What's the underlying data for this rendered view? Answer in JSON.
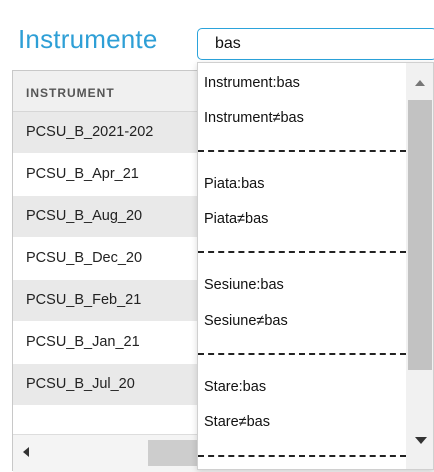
{
  "header": {
    "title": "Instrumente",
    "search_value": "bas"
  },
  "grid": {
    "column_header": "INSTRUMENT",
    "rows": [
      "PCSU_B_2021-202",
      "PCSU_B_Apr_21",
      "PCSU_B_Aug_20",
      "PCSU_B_Dec_20",
      "PCSU_B_Feb_21",
      "PCSU_B_Jan_21",
      "PCSU_B_Jul_20"
    ]
  },
  "dropdown": {
    "options": [
      "Instrument:bas",
      "Instrument≠bas",
      "Piata:bas",
      "Piata≠bas",
      "Sesiune:bas",
      "Sesiune≠bas",
      "Stare:bas",
      "Stare≠bas"
    ]
  },
  "icons": {
    "scroll_left": "arrow-left-icon",
    "scroll_up": "arrow-up-icon",
    "scroll_down": "arrow-down-icon"
  },
  "colors": {
    "title": "#2e9fd6",
    "search_border": "#2ba3db",
    "row_alt": "#e9e9e9"
  }
}
